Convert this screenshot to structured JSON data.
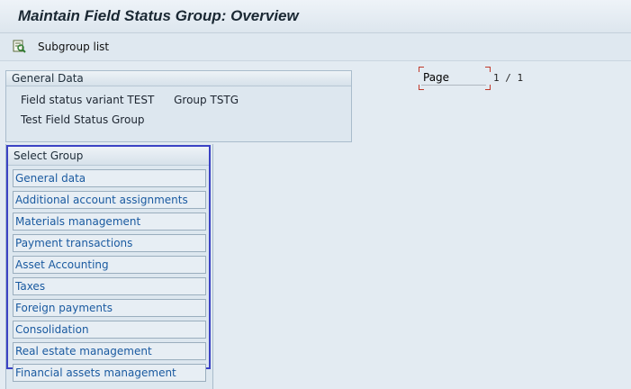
{
  "window": {
    "title": "Maintain Field Status Group: Overview"
  },
  "toolbar": {
    "icon": "subgroup-list-icon",
    "subgroup_list_label": "Subgroup list"
  },
  "general_data": {
    "header": "General Data",
    "field_status_variant_label": "Field status variant",
    "field_status_variant_value": "TEST",
    "group_label": "Group",
    "group_value": "TSTG",
    "description": "Test Field Status Group"
  },
  "select_group": {
    "header": "Select Group",
    "items": [
      {
        "label": "General data"
      },
      {
        "label": "Additional account assignments"
      },
      {
        "label": "Materials management"
      },
      {
        "label": "Payment transactions"
      },
      {
        "label": "Asset Accounting"
      },
      {
        "label": "Taxes"
      },
      {
        "label": "Foreign payments"
      },
      {
        "label": "Consolidation"
      },
      {
        "label": "Real estate management"
      },
      {
        "label": "Financial assets management"
      }
    ]
  },
  "pager": {
    "label": "Page",
    "current": "1",
    "separator": "/",
    "total": "1"
  },
  "colors": {
    "background": "#e3ebf2",
    "link": "#1a5aa0",
    "selection_frame": "#3b43c4",
    "page_corner": "#c0392b"
  }
}
